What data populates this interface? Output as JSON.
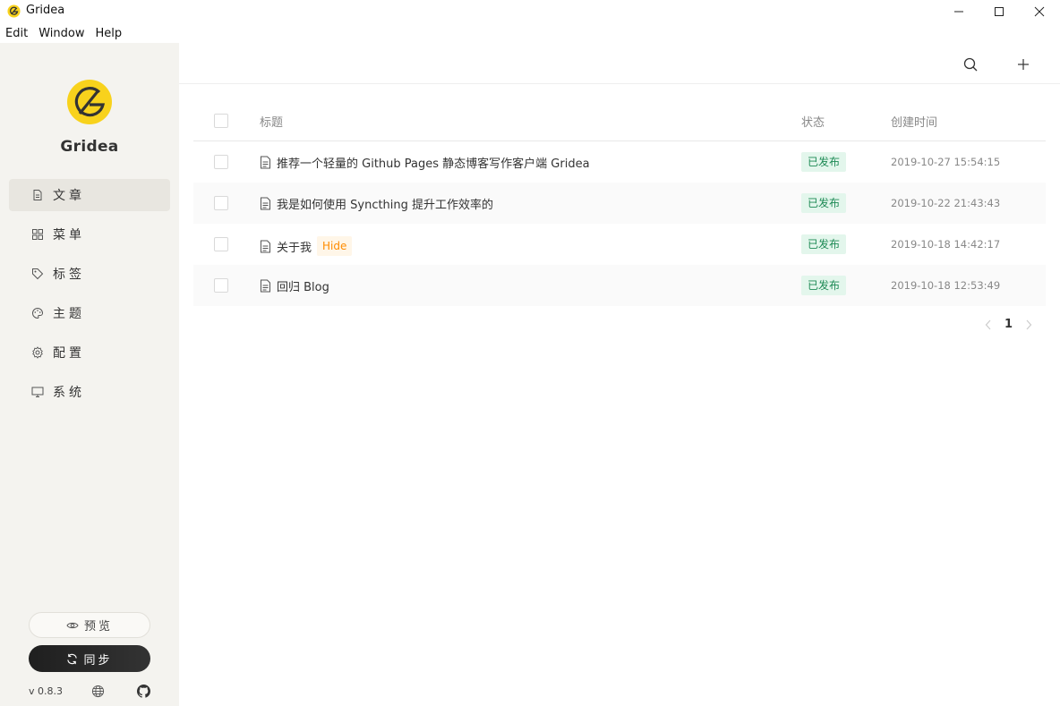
{
  "window": {
    "title": "Gridea",
    "controls": [
      "minimize",
      "maximize",
      "close"
    ]
  },
  "menubar": {
    "items": [
      "Edit",
      "Window",
      "Help"
    ]
  },
  "sidebar": {
    "brand": "Gridea",
    "items": [
      {
        "label": "文章",
        "icon": "file-icon",
        "active": true
      },
      {
        "label": "菜单",
        "icon": "grid-icon"
      },
      {
        "label": "标签",
        "icon": "tag-icon"
      },
      {
        "label": "主题",
        "icon": "palette-icon"
      },
      {
        "label": "配置",
        "icon": "gear-icon"
      },
      {
        "label": "系统",
        "icon": "monitor-icon"
      }
    ],
    "preview_label": "预览",
    "sync_label": "同步",
    "version": "v 0.8.3"
  },
  "toolbar": {
    "search_icon": "search-icon",
    "add_icon": "plus-icon"
  },
  "table": {
    "headers": {
      "title": "标题",
      "status": "状态",
      "created": "创建时间"
    },
    "rows": [
      {
        "title": "推荐一个轻量的 Github Pages 静态博客写作客户端 Gridea",
        "hidden_tag": "",
        "status": "已发布",
        "created": "2019-10-27 15:54:15"
      },
      {
        "title": "我是如何使用 Syncthing 提升工作效率的",
        "hidden_tag": "",
        "status": "已发布",
        "created": "2019-10-22 21:43:43"
      },
      {
        "title": "关于我",
        "hidden_tag": "Hide",
        "status": "已发布",
        "created": "2019-10-18 14:42:17"
      },
      {
        "title": "回归 Blog",
        "hidden_tag": "",
        "status": "已发布",
        "created": "2019-10-18 12:53:49"
      }
    ]
  },
  "pagination": {
    "current": "1"
  },
  "colors": {
    "accent": "#f8d21c",
    "status_bg": "#e3f6ec",
    "status_text": "#1e8a55",
    "hide_text": "#ff8c00",
    "sidebar_bg": "#f4f3ef"
  }
}
